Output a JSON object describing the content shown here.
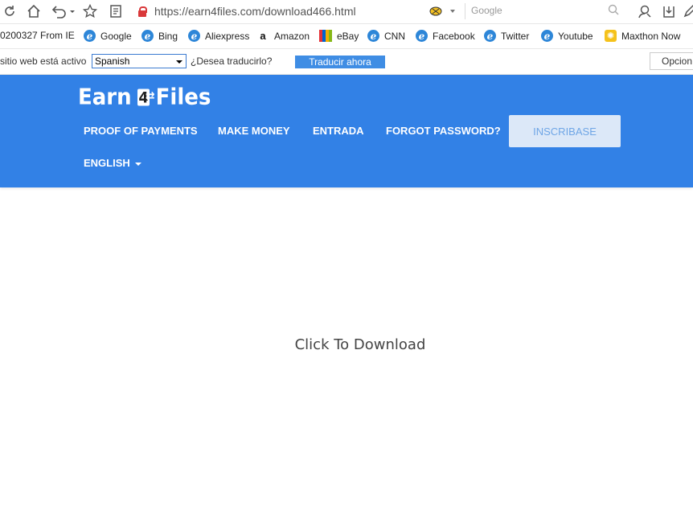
{
  "browser": {
    "url": "https://earn4files.com/download466.html",
    "search_placeholder": "Google",
    "icons": [
      "refresh-icon",
      "home-icon",
      "undo-icon",
      "favorite-icon",
      "reader-icon",
      "lock-icon",
      "extension-icon",
      "search-icon",
      "user-icon",
      "download-icon",
      "edit-icon"
    ]
  },
  "bookmarks": [
    {
      "label": "0200327 From IE",
      "icon": "none"
    },
    {
      "label": "Google",
      "icon": "ie"
    },
    {
      "label": "Bing",
      "icon": "ie"
    },
    {
      "label": "Aliexpress",
      "icon": "ie"
    },
    {
      "label": "Amazon",
      "icon": "amazon"
    },
    {
      "label": "eBay",
      "icon": "ebay"
    },
    {
      "label": "CNN",
      "icon": "ie"
    },
    {
      "label": "Facebook",
      "icon": "ie"
    },
    {
      "label": "Twitter",
      "icon": "ie"
    },
    {
      "label": "Youtube",
      "icon": "ie"
    },
    {
      "label": "Maxthon Now",
      "icon": "maxthon"
    }
  ],
  "translate_bar": {
    "prefix": "sitio web está activo",
    "language": "Spanish",
    "question": "¿Desea traducirlo?",
    "button": "Traducir ahora",
    "options": "Opcion"
  },
  "site": {
    "logo_left": "Earn",
    "logo_digit": "4",
    "logo_right": "Files",
    "nav": {
      "payments": "PROOF OF PAYMENTS",
      "make_money": "MAKE MONEY",
      "login": "ENTRADA",
      "forgot": "FORGOT PASSWORD?",
      "signup": "INSCRIBASE",
      "language": "ENGLISH"
    },
    "header_color": "#3281e6"
  },
  "main": {
    "download_text": "Click To Download"
  }
}
